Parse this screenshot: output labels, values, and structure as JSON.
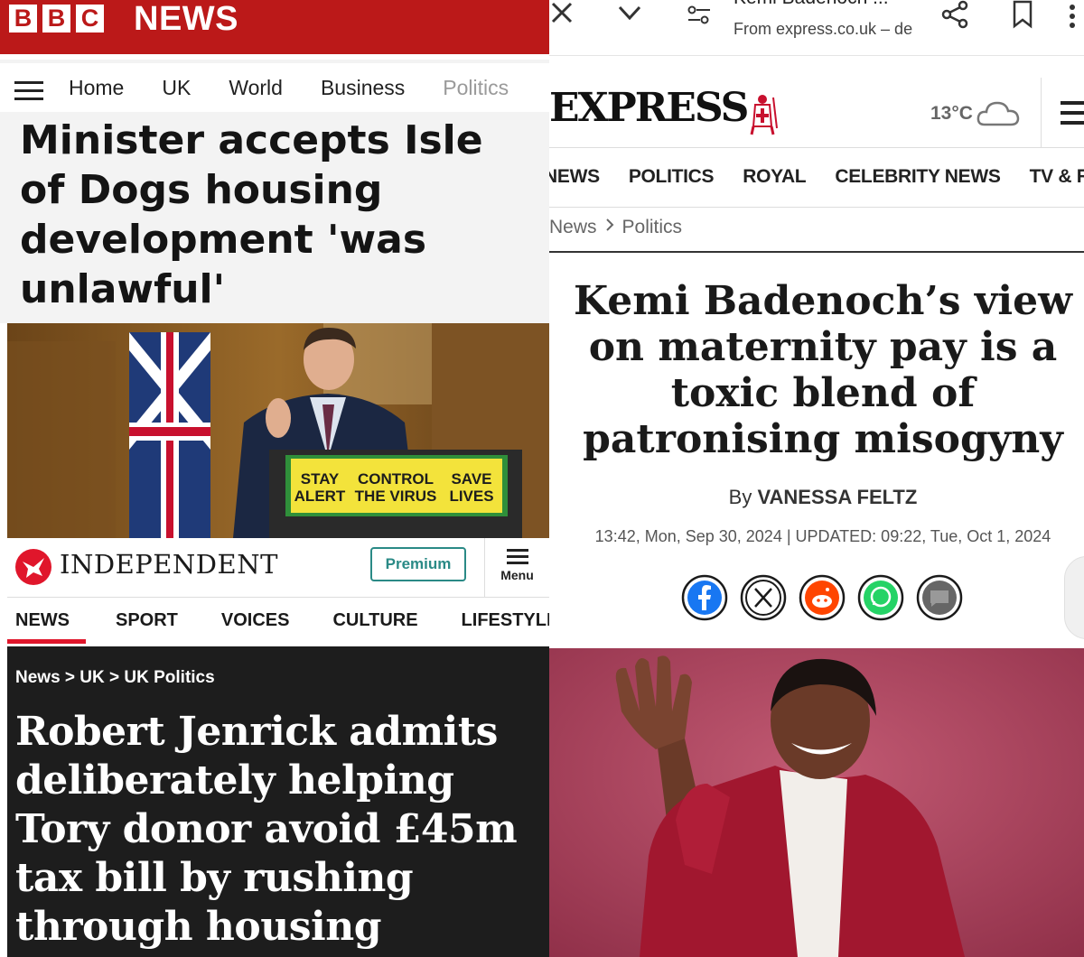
{
  "bbc": {
    "logo_letters": [
      "B",
      "B",
      "C"
    ],
    "logo_word": "NEWS",
    "nav": [
      "Home",
      "UK",
      "World",
      "Business",
      "Politics"
    ],
    "headline": "Minister accepts Isle of Dogs housing development 'was unlawful'"
  },
  "photo1": {
    "sign": {
      "left": "STAY\nALERT",
      "middle": "CONTROL\nTHE VIRUS",
      "right": "SAVE\nLIVES"
    },
    "colors": {
      "sign_yellow": "#f3e33b",
      "sign_green": "#2f8f3a"
    }
  },
  "independent": {
    "title": "INDEPENDENT",
    "premium": "Premium",
    "menu": "Menu",
    "nav": [
      "NEWS",
      "SPORT",
      "VOICES",
      "CULTURE",
      "LIFESTYLE"
    ],
    "breadcrumb": "News > UK > UK Politics",
    "headline": "Robert Jenrick admits deliberately helping Tory donor avoid £45m tax bill by rushing through housing development",
    "colors": {
      "accent": "#e0162b",
      "premium": "#2a8a86"
    }
  },
  "browser": {
    "title": "Kemi Badenoch ...",
    "url": "From express.co.uk – de",
    "icons": [
      "close-icon",
      "chevron-down-icon",
      "tune-icon",
      "share-icon",
      "bookmark-icon",
      "more-icon"
    ]
  },
  "express": {
    "logo": "EXPRESS",
    "temperature": "13°C",
    "nav": [
      "NEWS",
      "POLITICS",
      "ROYAL",
      "CELEBRITY NEWS",
      "TV & RADIO"
    ],
    "breadcrumb": [
      "News",
      "Politics"
    ],
    "headline": "Kemi Badenoch’s view on maternity pay is a toxic blend of patronising misogyny",
    "byline_prefix": "By",
    "author": "VANESSA FELTZ",
    "date": "13:42, Mon, Sep 30, 2024 | UPDATED: 09:22, Tue, Oct 1, 2024",
    "share_icons": [
      "facebook-icon",
      "x-icon",
      "reddit-icon",
      "whatsapp-icon",
      "comments-icon"
    ]
  }
}
